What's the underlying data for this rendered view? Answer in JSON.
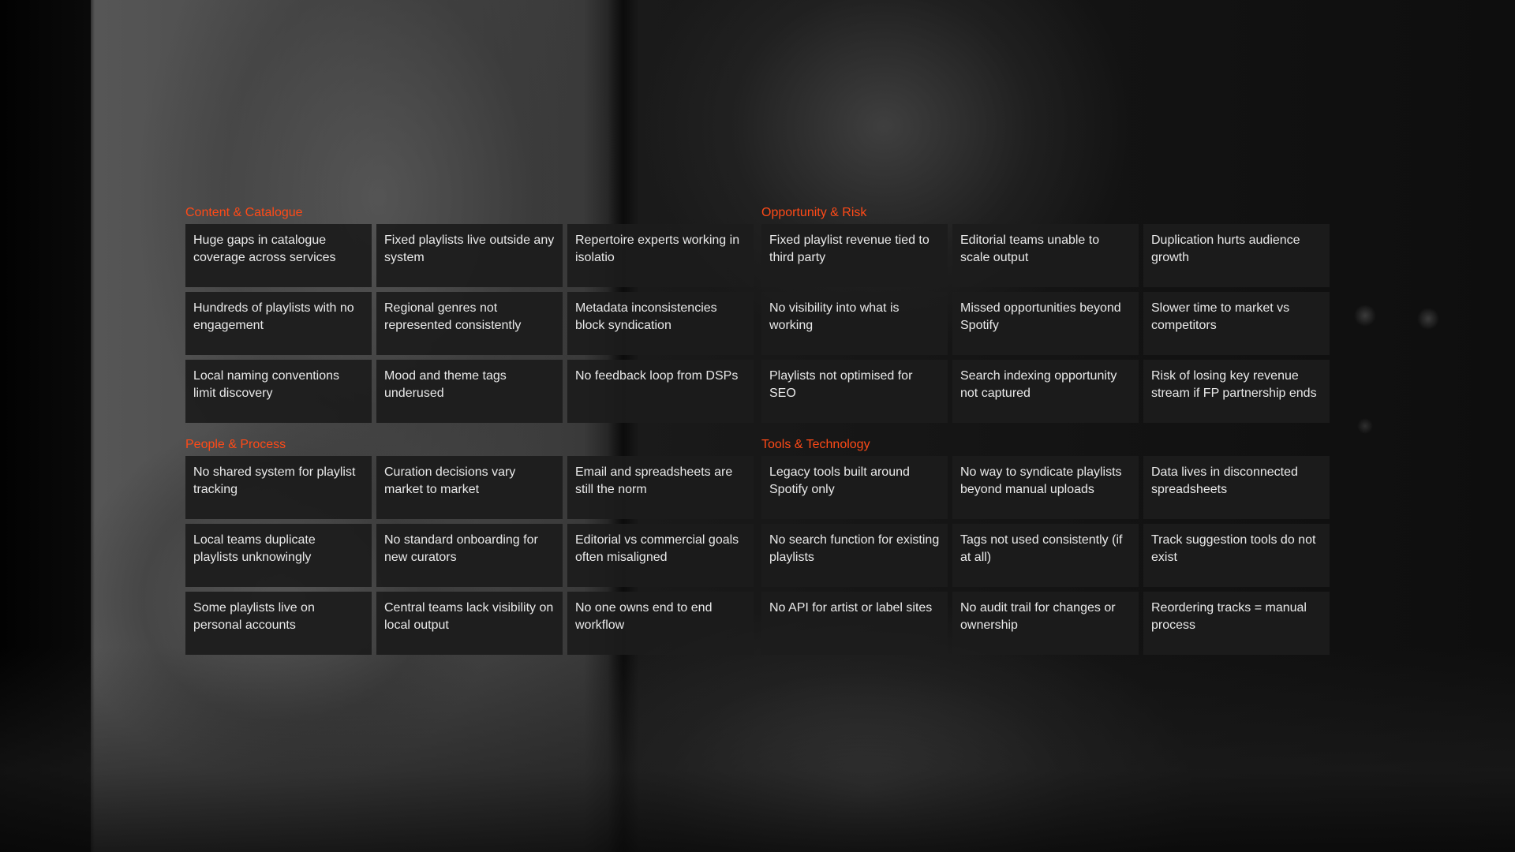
{
  "colors": {
    "accent": "#ff4a17",
    "card_background": "#1c1c1c",
    "card_text": "#e9e9e9"
  },
  "sections": [
    {
      "title": "Content & Catalogue",
      "items": [
        "Huge gaps in catalogue coverage across services",
        "Fixed playlists live outside any system",
        "Repertoire experts working in isolatio",
        "Hundreds of playlists with no engagement",
        "Regional genres not represented consistently",
        "Metadata inconsistencies block syndication",
        "Local naming conventions limit discovery",
        "Mood and theme tags underused",
        "No feedback loop from DSPs"
      ]
    },
    {
      "title": "Opportunity & Risk",
      "items": [
        "Fixed playlist revenue tied to third party",
        "Editorial teams unable to scale output",
        "Duplication hurts audience growth",
        "No visibility into what is working",
        "Missed opportunities beyond Spotify",
        "Slower time to market vs competitors",
        "Playlists not optimised for SEO",
        "Search indexing opportunity not captured",
        "Risk of losing key revenue stream if FP partnership ends"
      ]
    },
    {
      "title": "People & Process",
      "items": [
        "No shared system for playlist tracking",
        "Curation decisions vary market to market",
        "Email and spreadsheets are still the norm",
        "Local teams duplicate playlists unknowingly",
        "No standard onboarding for new curators",
        "Editorial vs commercial goals often misaligned",
        "Some playlists live on personal accounts",
        "Central teams lack visibility on local output",
        "No one owns end to end workflow"
      ]
    },
    {
      "title": "Tools & Technology",
      "items": [
        "Legacy tools built around Spotify only",
        "No way to syndicate playlists beyond manual uploads",
        "Data lives in disconnected spreadsheets",
        "No search function for existing playlists",
        "Tags not used consistently (if at all)",
        "Track suggestion tools do not exist",
        "No API for artist or label sites",
        "No audit trail for changes or ownership",
        "Reordering tracks = manual process"
      ]
    }
  ]
}
